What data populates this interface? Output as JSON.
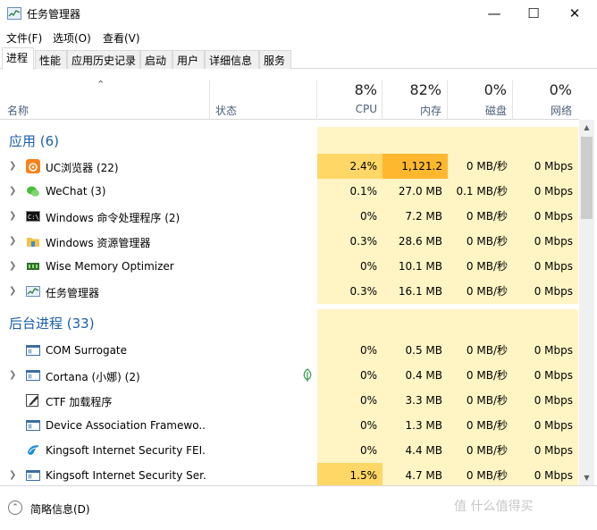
{
  "window": {
    "title": "任务管理器",
    "controls": {
      "minimize": "—",
      "maximize": "☐",
      "close": "✕"
    }
  },
  "menu": [
    "文件(F)",
    "选项(O)",
    "查看(V)"
  ],
  "tabs": [
    "进程",
    "性能",
    "应用历史记录",
    "启动",
    "用户",
    "详细信息",
    "服务"
  ],
  "active_tab": "进程",
  "columns": {
    "name": "名称",
    "status": "状态",
    "cpu": {
      "percent": "8%",
      "label": "CPU"
    },
    "memory": {
      "percent": "82%",
      "label": "内存"
    },
    "disk": {
      "percent": "0%",
      "label": "磁盘"
    },
    "network": {
      "percent": "0%",
      "label": "网络"
    }
  },
  "groups": [
    {
      "title": "应用 (6)",
      "rows": [
        {
          "name": "UC浏览器 (22)",
          "icon": "uc-browser-icon",
          "expandable": true,
          "cpu": "2.4%",
          "memory": "1,121.2",
          "disk": "0 MB/秒",
          "network": "0 Mbps"
        },
        {
          "name": "WeChat (3)",
          "icon": "wechat-icon",
          "expandable": true,
          "cpu": "0.1%",
          "memory": "27.0 MB",
          "disk": "0.1 MB/秒",
          "network": "0 Mbps"
        },
        {
          "name": "Windows 命令处理程序 (2)",
          "icon": "cmd-icon",
          "expandable": true,
          "cpu": "0%",
          "memory": "7.2 MB",
          "disk": "0 MB/秒",
          "network": "0 Mbps"
        },
        {
          "name": "Windows 资源管理器",
          "icon": "explorer-icon",
          "expandable": true,
          "cpu": "0.3%",
          "memory": "28.6 MB",
          "disk": "0 MB/秒",
          "network": "0 Mbps"
        },
        {
          "name": "Wise Memory Optimizer",
          "icon": "memory-optimizer-icon",
          "expandable": true,
          "cpu": "0%",
          "memory": "10.1 MB",
          "disk": "0 MB/秒",
          "network": "0 Mbps"
        },
        {
          "name": "任务管理器",
          "icon": "task-manager-icon",
          "expandable": true,
          "cpu": "0.3%",
          "memory": "16.1 MB",
          "disk": "0 MB/秒",
          "network": "0 Mbps"
        }
      ]
    },
    {
      "title": "后台进程 (33)",
      "rows": [
        {
          "name": "COM Surrogate",
          "icon": "window-app-icon",
          "expandable": false,
          "cpu": "0%",
          "memory": "0.5 MB",
          "disk": "0 MB/秒",
          "network": "0 Mbps"
        },
        {
          "name": "Cortana (小娜) (2)",
          "icon": "window-app-icon",
          "expandable": true,
          "status_icon": "leaf-icon",
          "cpu": "0%",
          "memory": "0.4 MB",
          "disk": "0 MB/秒",
          "network": "0 Mbps"
        },
        {
          "name": "CTF 加载程序",
          "icon": "ctf-pen-icon",
          "expandable": false,
          "cpu": "0%",
          "memory": "3.3 MB",
          "disk": "0 MB/秒",
          "network": "0 Mbps"
        },
        {
          "name": "Device Association Framewo...",
          "icon": "window-app-icon",
          "expandable": false,
          "cpu": "0%",
          "memory": "1.3 MB",
          "disk": "0 MB/秒",
          "network": "0 Mbps"
        },
        {
          "name": "Kingsoft Internet Security FEI...",
          "icon": "kingsoft-icon",
          "expandable": false,
          "cpu": "0%",
          "memory": "4.4 MB",
          "disk": "0 MB/秒",
          "network": "0 Mbps"
        },
        {
          "name": "Kingsoft Internet Security Ser...",
          "icon": "window-app-icon",
          "expandable": true,
          "cpu": "1.5%",
          "memory": "4.7 MB",
          "disk": "0 MB/秒",
          "network": "0 Mbps"
        }
      ]
    }
  ],
  "footer": {
    "fewer_details": "简略信息(D)",
    "watermark": "值 什么值得买"
  }
}
